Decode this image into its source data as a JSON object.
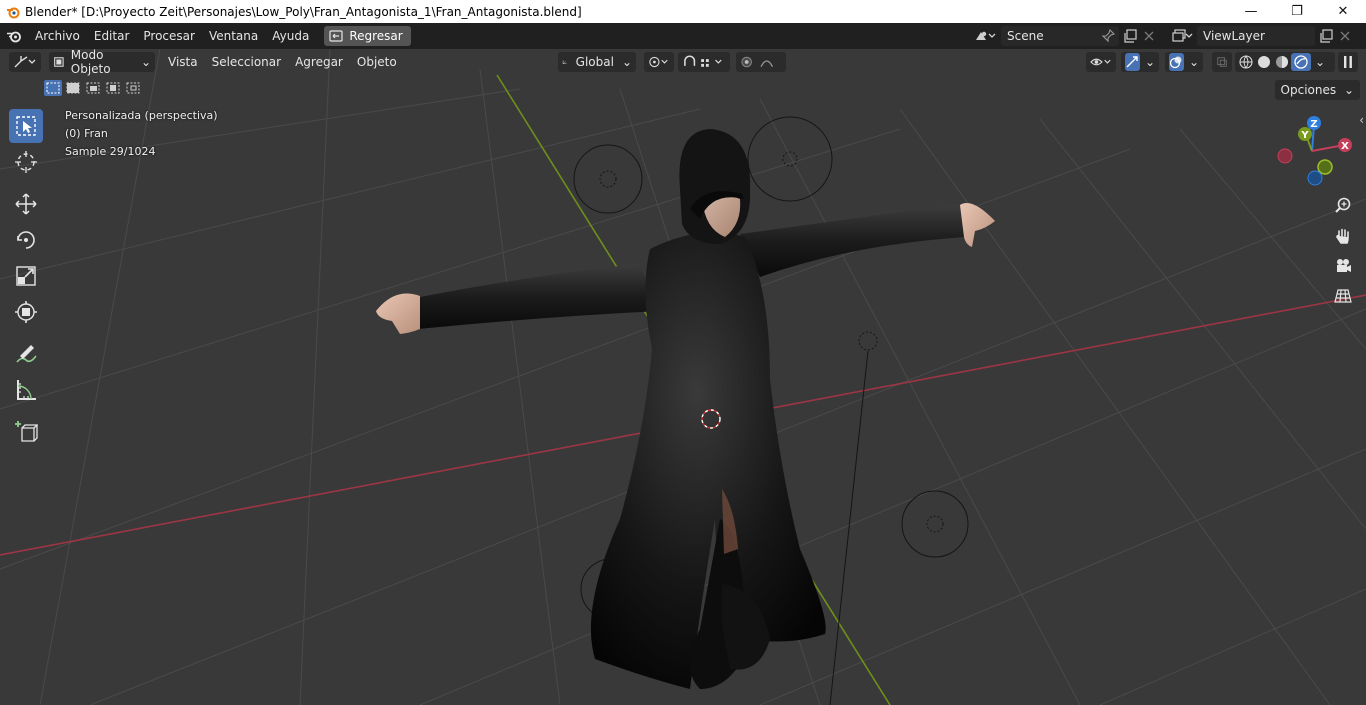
{
  "window": {
    "title": "Blender* [D:\\Proyecto Zeit\\Personajes\\Low_Poly\\Fran_Antagonista_1\\Fran_Antagonista.blend]",
    "minimize": "—",
    "restore": "❐",
    "close": "✕"
  },
  "topbar": {
    "menus": [
      "Archivo",
      "Editar",
      "Procesar",
      "Ventana",
      "Ayuda"
    ],
    "back_label": "Regresar",
    "scene_name": "Scene",
    "view_layer": "ViewLayer"
  },
  "viewport_header": {
    "mode": "Modo Objeto",
    "menus": [
      "Vista",
      "Seleccionar",
      "Agregar",
      "Objeto"
    ],
    "orientation": "Global",
    "options_label": "Opciones"
  },
  "viewport_overlay": {
    "view_name": "Personalizada (perspectiva)",
    "object_info": "(0) Fran",
    "sample_info": "Sample 29/1024"
  },
  "gizmo": {
    "z_label": "Z",
    "y_label": "Y",
    "x_label": "X"
  },
  "colors": {
    "accent": "#4772b3",
    "x_axis": "#c4405a",
    "y_axis": "#7a9a1e",
    "z_axis": "#2f7fe0",
    "viewport_bg": "#393939"
  },
  "icons": {
    "tools": [
      "select-box-icon",
      "cursor-icon",
      "move-icon",
      "rotate-icon",
      "scale-icon",
      "transform-icon",
      "annotate-icon",
      "measure-icon",
      "add-cube-icon"
    ],
    "nav": [
      "zoom-icon",
      "pan-hand-icon",
      "camera-icon",
      "grid-perspective-icon"
    ]
  }
}
